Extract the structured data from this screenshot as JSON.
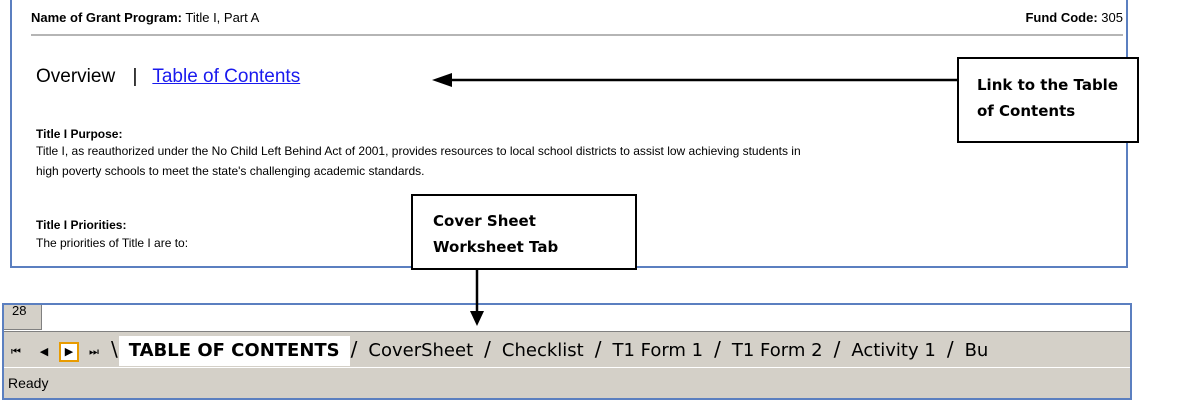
{
  "doc": {
    "grant_label": "Name of Grant Program:",
    "grant_value": "Title I, Part A",
    "fund_label": "Fund Code:",
    "fund_value": "305",
    "overview_label": "Overview",
    "separator": "|",
    "toc_link": "Table of Contents",
    "purpose_title": "Title I Purpose:",
    "purpose_text_1": "Title I, as reauthorized under the No Child Left Behind Act of 2001, provides resources to local school districts to assist low achieving students in",
    "purpose_text_2": "high poverty schools to meet the state's challenging academic standards.",
    "priorities_title": "Title I Priorities:",
    "priorities_text": "The priorities of Title I are to:"
  },
  "callouts": {
    "toc_line1": "Link to the Table",
    "toc_line2": "of Contents",
    "cover_line1": "Cover Sheet",
    "cover_line2": "Worksheet Tab"
  },
  "excel": {
    "row_number": "28",
    "nav_first": "⏮",
    "nav_prev": "◀",
    "nav_next": "▶",
    "nav_last": "⏭",
    "tabs": [
      "TABLE OF CONTENTS",
      "CoverSheet",
      "Checklist",
      "T1 Form 1",
      "T1 Form 2",
      "Activity 1",
      "Bu"
    ],
    "active_tab": "TABLE OF CONTENTS",
    "status": "Ready"
  },
  "colors": {
    "frame": "#5b7fc0",
    "link": "#1a1aee",
    "highlight": "#e89b00"
  }
}
